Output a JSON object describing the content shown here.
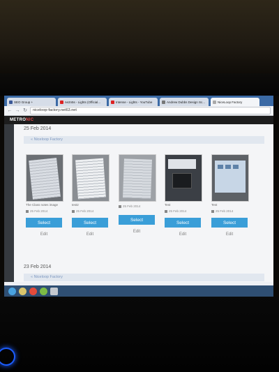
{
  "browser": {
    "tabs": [
      {
        "label": "SEO Group +"
      },
      {
        "label": "ne2n5s - Lights (Official..."
      },
      {
        "label": "Intense - Lights - YouTube"
      },
      {
        "label": "Andrew Dubbs Design Sc..."
      },
      {
        "label": "NiceLoop Factory"
      }
    ],
    "url": "niceloop-factory.net63.net"
  },
  "app": {
    "brand_main": "METRO",
    "brand_accent": "NIC"
  },
  "groups": [
    {
      "date": "25 Feb 2014",
      "breadcrumb": "« Niceloop Factory"
    },
    {
      "date": "23 Feb 2014",
      "breadcrumb": "« Niceloop Factory"
    }
  ],
  "cards": [
    {
      "caption": "The Class notes image",
      "date": "25 Feb 2014",
      "select": "Select",
      "edit": "Edit"
    },
    {
      "caption": "test2",
      "date": "25 Feb 2014",
      "select": "Select",
      "edit": "Edit"
    },
    {
      "caption": "",
      "date": "25 Feb 2014",
      "select": "Select",
      "edit": "Edit"
    },
    {
      "caption": "Test",
      "date": "25 Feb 2014",
      "select": "Select",
      "edit": "Edit"
    },
    {
      "caption": "Test",
      "date": "25 Feb 2014",
      "select": "Select",
      "edit": "Edit"
    }
  ],
  "colors": {
    "accent": "#3a9ed8",
    "topbar": "#1d1d1d",
    "led": "#1c5dff"
  }
}
